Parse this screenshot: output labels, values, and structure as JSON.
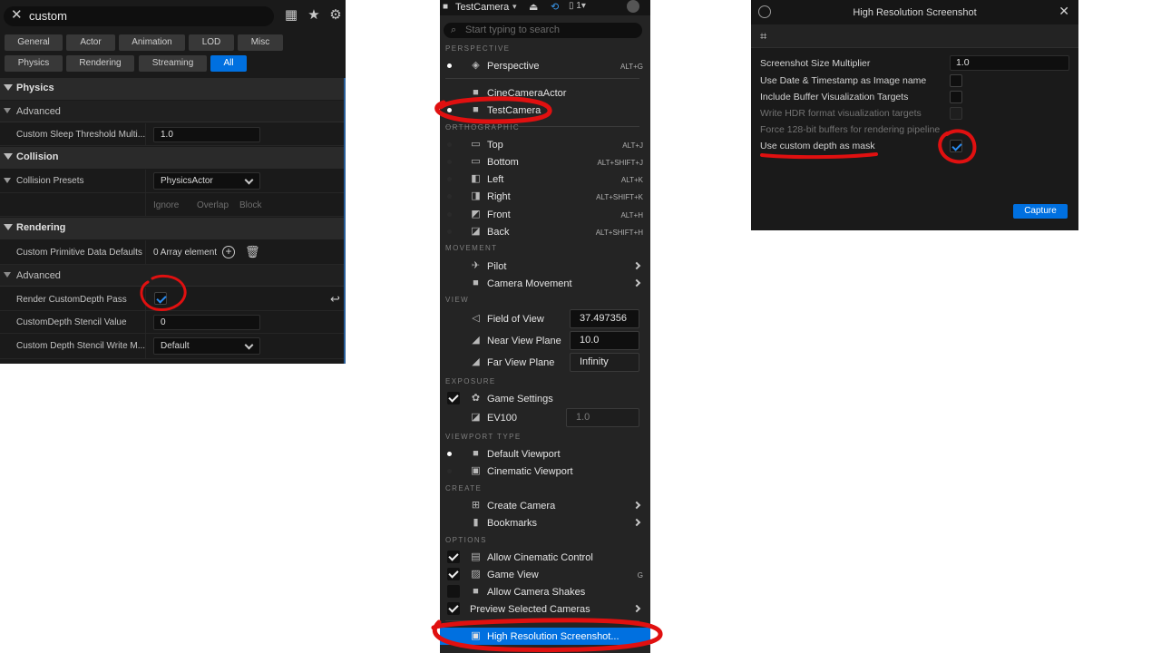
{
  "details": {
    "search_query": "custom",
    "filters_row1": [
      "General",
      "Actor",
      "Animation",
      "LOD",
      "Misc"
    ],
    "filters_row2": [
      "Physics",
      "Rendering",
      "Streaming",
      "All"
    ],
    "physics": {
      "title": "Physics",
      "advanced": "Advanced",
      "sleep_label": "Custom Sleep Threshold Multi...",
      "sleep_value": "1.0"
    },
    "collision": {
      "title": "Collision",
      "presets_label": "Collision Presets",
      "presets_value": "PhysicsActor",
      "col_ignore": "Ignore",
      "col_overlap": "Overlap",
      "col_block": "Block"
    },
    "rendering": {
      "title": "Rendering",
      "primitive_label": "Custom Primitive Data Defaults",
      "primitive_value": "0 Array element",
      "advanced": "Advanced",
      "render_depth_label": "Render CustomDepth Pass",
      "stencil_label": "CustomDepth Stencil Value",
      "stencil_value": "0",
      "write_mask_label": "Custom Depth Stencil Write M...",
      "write_mask_value": "Default"
    }
  },
  "viewport_menu": {
    "camera_tab": "TestCamera",
    "search_placeholder": "Start typing to search",
    "perspective_header": "PERSPECTIVE",
    "perspective": "Perspective",
    "perspective_sc": "ALT+G",
    "cine_camera": "CineCameraActor",
    "test_camera": "TestCamera",
    "ortho_header": "ORTHOGRAPHIC",
    "top": "Top",
    "top_sc": "ALT+J",
    "bottom": "Bottom",
    "bottom_sc": "ALT+SHIFT+J",
    "left": "Left",
    "left_sc": "ALT+K",
    "right": "Right",
    "right_sc": "ALT+SHIFT+K",
    "front": "Front",
    "front_sc": "ALT+H",
    "back": "Back",
    "back_sc": "ALT+SHIFT+H",
    "movement_header": "MOVEMENT",
    "pilot": "Pilot",
    "camera_movement": "Camera Movement",
    "view_header": "VIEW",
    "fov": "Field of View",
    "fov_value": "37.497356",
    "near": "Near View Plane",
    "near_value": "10.0",
    "far": "Far View Plane",
    "far_value": "Infinity",
    "exposure_header": "EXPOSURE",
    "game_settings": "Game Settings",
    "ev100": "EV100",
    "ev100_value": "1.0",
    "viewport_type_header": "VIEWPORT TYPE",
    "default_viewport": "Default Viewport",
    "cinematic_viewport": "Cinematic Viewport",
    "create_header": "CREATE",
    "create_camera": "Create Camera",
    "bookmarks": "Bookmarks",
    "options_header": "OPTIONS",
    "allow_cinematic": "Allow Cinematic Control",
    "game_view": "Game View",
    "game_view_sc": "G",
    "allow_shakes": "Allow Camera Shakes",
    "preview_cameras": "Preview Selected Cameras",
    "high_res": "High Resolution Screenshot..."
  },
  "hires": {
    "title": "High Resolution Screenshot",
    "size_label": "Screenshot Size Multiplier",
    "size_value": "1.0",
    "date_label": "Use Date & Timestamp as Image name",
    "buffer_label": "Include Buffer Visualization Targets",
    "hdr_label": "Write HDR format visualization targets",
    "force_label": "Force 128-bit buffers for rendering pipeline",
    "mask_label": "Use custom depth as mask",
    "capture": "Capture"
  },
  "colors": {
    "accent": "#0070e0",
    "annotation": "#e01010"
  }
}
